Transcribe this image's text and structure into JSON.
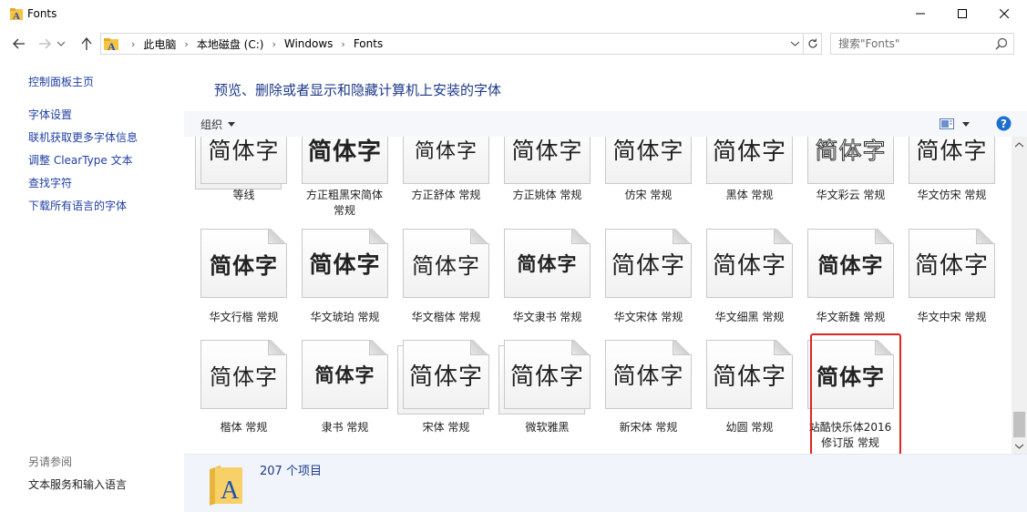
{
  "window": {
    "title": "Fonts"
  },
  "address": {
    "crumbs": [
      "此电脑",
      "本地磁盘 (C:)",
      "Windows",
      "Fonts"
    ],
    "search_placeholder": "搜索\"Fonts\""
  },
  "sidebar": {
    "top_links": [
      "控制面板主页",
      "字体设置",
      "联机获取更多字体信息",
      "调整 ClearType 文本",
      "查找字符",
      "下载所有语言的字体"
    ],
    "see_also_heading": "另请参阅",
    "see_also_links": [
      "文本服务和输入语言"
    ]
  },
  "main": {
    "title": "预览、删除或者显示和隐藏计算机上安装的字体",
    "organize_label": "组织",
    "sample_text": "简体字",
    "item_count": "207 个项目"
  },
  "fonts": [
    {
      "label": "等线",
      "stack": true
    },
    {
      "label": "方正粗黑宋简体 常规",
      "stack": false
    },
    {
      "label": "方正舒体 常规",
      "stack": false
    },
    {
      "label": "方正姚体 常规",
      "stack": false
    },
    {
      "label": "仿宋 常规",
      "stack": false
    },
    {
      "label": "黑体 常规",
      "stack": false
    },
    {
      "label": "华文彩云 常规",
      "stack": false
    },
    {
      "label": "华文仿宋 常规",
      "stack": false
    },
    {
      "label": "华文行楷 常规",
      "stack": false
    },
    {
      "label": "华文琥珀 常规",
      "stack": false
    },
    {
      "label": "华文楷体 常规",
      "stack": false
    },
    {
      "label": "华文隶书 常规",
      "stack": false
    },
    {
      "label": "华文宋体 常规",
      "stack": false
    },
    {
      "label": "华文细黑 常规",
      "stack": false
    },
    {
      "label": "华文新魏 常规",
      "stack": false
    },
    {
      "label": "华文中宋 常规",
      "stack": false
    },
    {
      "label": "楷体 常规",
      "stack": false
    },
    {
      "label": "隶书 常规",
      "stack": false
    },
    {
      "label": "宋体 常规",
      "stack": true
    },
    {
      "label": "微软雅黑",
      "stack": true
    },
    {
      "label": "新宋体 常规",
      "stack": false
    },
    {
      "label": "幼圆 常规",
      "stack": false
    },
    {
      "label": "站酷快乐体2016修订版 常规",
      "stack": false,
      "selected": true
    }
  ],
  "colors": {
    "link": "#1f3ea3",
    "title": "#1e3a8a",
    "selection_outline": "#e02424"
  }
}
